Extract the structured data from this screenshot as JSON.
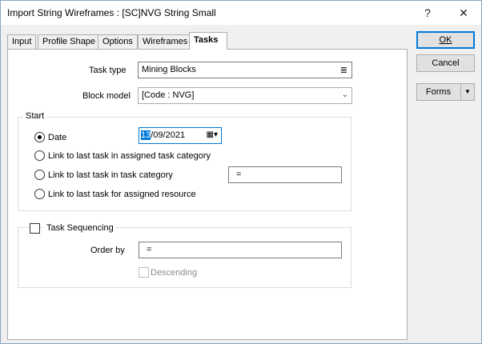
{
  "window": {
    "title": "Import String Wireframes : [SC]NVG String Small",
    "help_label": "?",
    "close_label": "✕"
  },
  "tabs": [
    {
      "label": "Input"
    },
    {
      "label": "Profile Shape"
    },
    {
      "label": "Options"
    },
    {
      "label": "Wireframes"
    },
    {
      "label": "Tasks"
    }
  ],
  "task_type": {
    "label": "Task type",
    "value": "Mining Blocks",
    "browse_icon": "≣"
  },
  "block_model": {
    "label": "Block model",
    "value": "[Code : NVG]"
  },
  "start": {
    "title": "Start",
    "date_label": "Date",
    "date_day": "13",
    "date_rest": "/09/2021",
    "link_assigned_category": "Link to last task in assigned task category",
    "link_task_category": "Link to last task in task category",
    "link_task_category_value": "=",
    "link_assigned_resource": "Link to last task for assigned resource"
  },
  "sequencing": {
    "title": "Task Sequencing",
    "order_by_label": "Order by",
    "order_by_value": "=",
    "descending_label": "Descending"
  },
  "buttons": {
    "ok": "OK",
    "cancel": "Cancel",
    "forms": "Forms"
  }
}
